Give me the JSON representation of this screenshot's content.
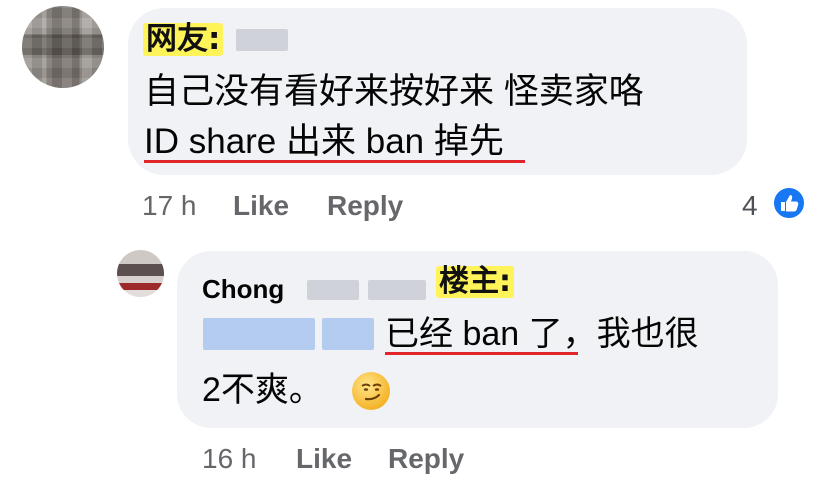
{
  "comment1": {
    "label": "网友:",
    "text_line1": "自己没有看好来按好来 怪卖家咯",
    "text_line2": "ID share 出来 ban 掉先",
    "time": "17 h",
    "like": "Like",
    "reply": "Reply",
    "reaction_count": "4",
    "reaction_icon": "like-thumb-icon"
  },
  "comment2": {
    "name": "Chong",
    "label": "楼主:",
    "text_line1": "已经 ban 了，我也很",
    "text_line2": "2不爽。",
    "emoji": "smirk-emoji",
    "time": "16 h",
    "like": "Like",
    "reply": "Reply"
  },
  "colors": {
    "bubble": "#f0f2f5",
    "highlight": "#fff35a",
    "underline": "#e0252b",
    "meta": "#65676b",
    "like_blue": "#1877f2"
  }
}
